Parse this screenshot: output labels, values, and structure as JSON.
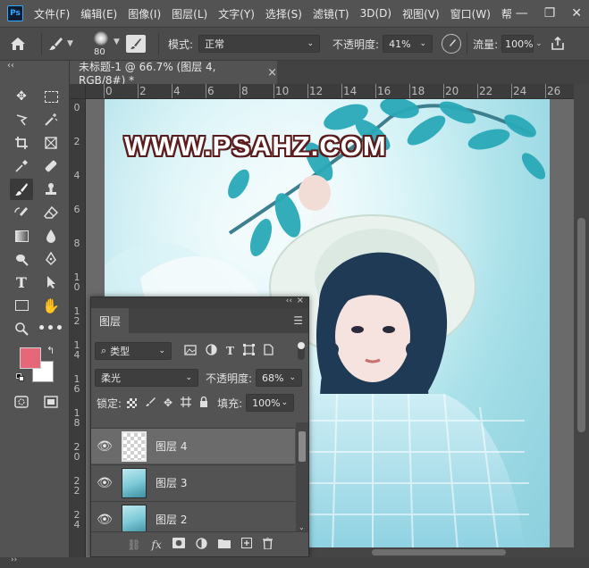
{
  "app": {
    "logo": "Ps"
  },
  "menu": [
    "文件(F)",
    "编辑(E)",
    "图像(I)",
    "图层(L)",
    "文字(Y)",
    "选择(S)",
    "滤镜(T)",
    "3D(D)",
    "视图(V)",
    "窗口(W)",
    "帮"
  ],
  "window_controls": {
    "minimize": "—",
    "restore": "❐",
    "close": "✕"
  },
  "options": {
    "brush_size": "80",
    "mode_label": "模式:",
    "mode_value": "正常",
    "opacity_label": "不透明度:",
    "opacity_value": "41%",
    "flow_label": "流量:",
    "flow_value": "100%"
  },
  "colors": {
    "foreground": "#e7677a",
    "background": "#ffffff"
  },
  "document": {
    "tab_title": "未标题-1 @ 66.7% (图层 4, RGB/8#) *",
    "close": "×",
    "watermark": "WWW.PSAHZ.COM"
  },
  "rulers": {
    "h": [
      "0",
      "2",
      "4",
      "6",
      "8",
      "10",
      "12",
      "14",
      "16",
      "18",
      "20",
      "22",
      "24",
      "26"
    ],
    "v": [
      "0",
      "2",
      "4",
      "6",
      "8",
      "10",
      "12",
      "14",
      "16",
      "18",
      "20",
      "22",
      "24"
    ]
  },
  "layers_panel": {
    "collapse": "‹‹",
    "close": "×",
    "tab": "图层",
    "filter_value": "类型",
    "blend_mode": "柔光",
    "opacity_label": "不透明度:",
    "opacity_value": "68%",
    "lock_label": "锁定:",
    "fill_label": "填充:",
    "fill_value": "100%",
    "layers": [
      {
        "name": "图层 4",
        "selected": true,
        "thumb": "transparent"
      },
      {
        "name": "图层 3",
        "selected": false,
        "thumb": "photo"
      },
      {
        "name": "图层 2",
        "selected": false,
        "thumb": "photo"
      }
    ]
  }
}
